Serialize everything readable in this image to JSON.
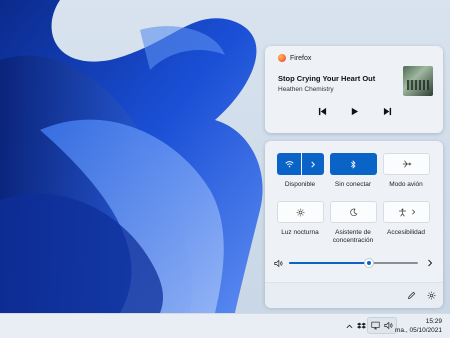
{
  "media": {
    "app_name": "Firefox",
    "song_title": "Stop Crying Your Heart Out",
    "artist": "Heathen Chemistry",
    "album_art": "album-cover",
    "controls": [
      "previous-icon",
      "play-icon",
      "next-icon"
    ]
  },
  "quick_settings": {
    "tiles": [
      {
        "label": "Disponible",
        "icon": "wifi-icon",
        "state": "on"
      },
      {
        "label": "Sin conectar",
        "icon": "bluetooth-icon",
        "state": "on"
      },
      {
        "label": "Modo avión",
        "icon": "airplane-icon",
        "state": "off"
      },
      {
        "label": "Luz nocturna",
        "icon": "brightness-icon",
        "state": "off"
      },
      {
        "label": "Asistente de concentración",
        "icon": "moon-icon",
        "state": "off"
      },
      {
        "label": "Accesibilidad",
        "icon": "accessibility-icon",
        "state": "off"
      }
    ],
    "volume_level": 0.62
  },
  "taskbar": {
    "time": "15:29",
    "date": "ma., 05/10/2021"
  },
  "colors": {
    "accent": "#0a64c8",
    "panel": "#eef2f7",
    "wallpaper_blue": "#1a4fd0"
  }
}
